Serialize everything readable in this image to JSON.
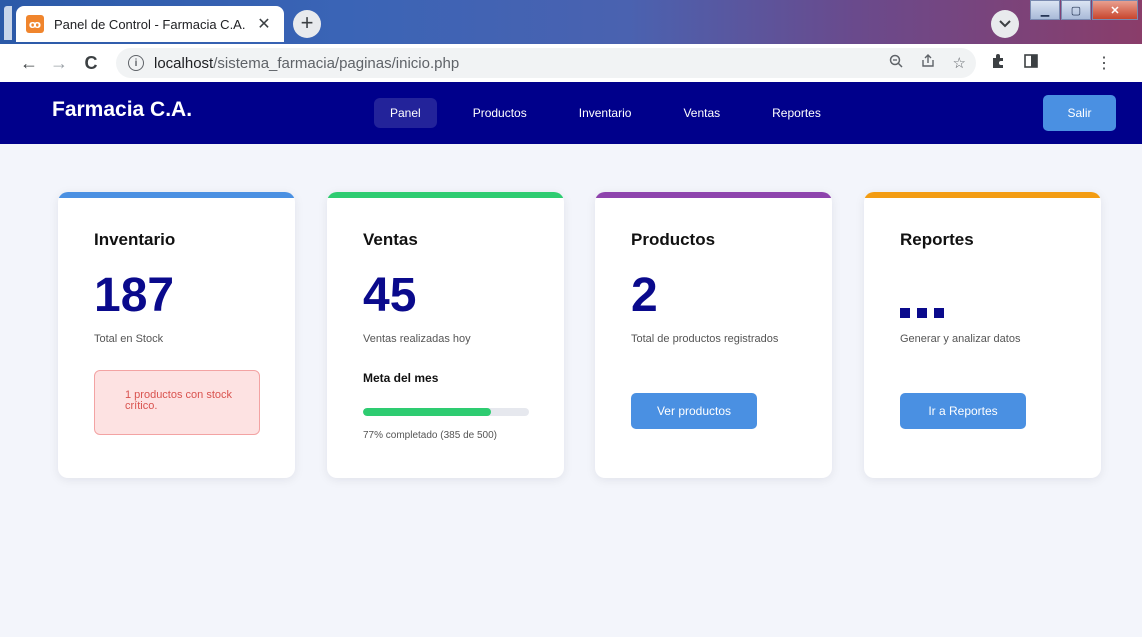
{
  "browser": {
    "tab_title": "Panel de Control - Farmacia C.A.",
    "tab_close": "✕",
    "new_tab": "+",
    "url_host": "localhost",
    "url_path": "/sistema_farmacia/paginas/inicio.php"
  },
  "app": {
    "brand": "Farmacia C.A.",
    "nav": [
      {
        "label": "Panel",
        "active": true
      },
      {
        "label": "Productos"
      },
      {
        "label": "Inventario"
      },
      {
        "label": "Ventas"
      },
      {
        "label": "Reportes"
      }
    ],
    "logout_label": "Salir"
  },
  "cards": {
    "inventario": {
      "title": "Inventario",
      "value": "187",
      "subtitle": "Total en Stock",
      "alert": "1 productos con stock crítico.",
      "accent": "#4a90e2"
    },
    "ventas": {
      "title": "Ventas",
      "value": "45",
      "subtitle": "Ventas realizadas hoy",
      "goal_title": "Meta del mes",
      "progress_percent": 77,
      "progress_text": "77% completado (385 de 500)",
      "accent": "#2ecc71"
    },
    "productos": {
      "title": "Productos",
      "value": "2",
      "subtitle": "Total de productos registrados",
      "button": "Ver productos",
      "accent": "#8e44ad"
    },
    "reportes": {
      "title": "Reportes",
      "subtitle": "Generar y analizar datos",
      "button": "Ir a Reportes",
      "accent": "#f39c12"
    }
  }
}
